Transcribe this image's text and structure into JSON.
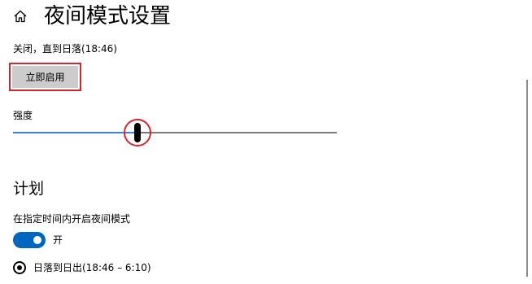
{
  "header": {
    "title": "夜间模式设置",
    "home_icon": "home-icon"
  },
  "status": {
    "text": "关闭，直到日落(18:46)"
  },
  "enable_button": {
    "label": "立即启用"
  },
  "strength": {
    "label": "强度",
    "value_fraction": 0.39
  },
  "schedule": {
    "heading": "计划",
    "toggle_label": "在指定时间内开启夜间模式",
    "toggle_state": "开",
    "toggle_on": true,
    "option_label": "日落到日出(18:46 – 6:10)",
    "option_selected": true
  },
  "colors": {
    "accent": "#0067c0",
    "slider_fill": "#3c84d7",
    "highlight": "#d6252f",
    "button_bg": "#cccccc"
  }
}
